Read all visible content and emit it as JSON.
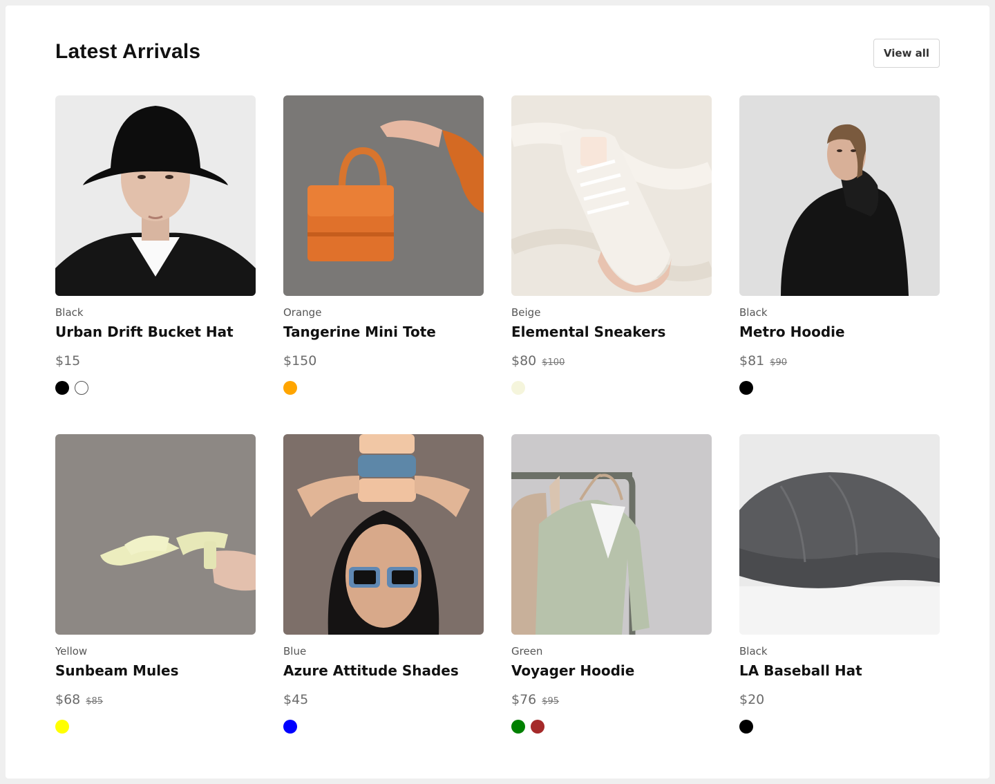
{
  "section": {
    "title": "Latest Arrivals",
    "view_all_label": "View all"
  },
  "products": [
    {
      "color": "Black",
      "name": "Urban Drift Bucket Hat",
      "price": "$15",
      "old_price": "",
      "swatches": [
        "#000000",
        "#ffffff"
      ],
      "image": "man-in-black-bucket-hat"
    },
    {
      "color": "Orange",
      "name": "Tangerine Mini Tote",
      "price": "$150",
      "old_price": "",
      "swatches": [
        "#ffa500"
      ],
      "image": "hand-holding-orange-mini-bag"
    },
    {
      "color": "Beige",
      "name": "Elemental Sneakers",
      "price": "$80",
      "old_price": "$100",
      "swatches": [
        "#f5f5dc"
      ],
      "image": "white-sneaker-on-cream-fabric"
    },
    {
      "color": "Black",
      "name": "Metro Hoodie",
      "price": "$81",
      "old_price": "$90",
      "swatches": [
        "#000000"
      ],
      "image": "woman-in-black-hoodie"
    },
    {
      "color": "Yellow",
      "name": "Sunbeam Mules",
      "price": "$68",
      "old_price": "$85",
      "swatches": [
        "#ffff00"
      ],
      "image": "hand-holding-yellow-mules"
    },
    {
      "color": "Blue",
      "name": "Azure Attitude Shades",
      "price": "$45",
      "old_price": "",
      "swatches": [
        "#0000ff"
      ],
      "image": "woman-with-blue-sunglasses"
    },
    {
      "color": "Green",
      "name": "Voyager Hoodie",
      "price": "$76",
      "old_price": "$95",
      "swatches": [
        "#008000",
        "#a52a2a"
      ],
      "image": "green-hoodie-on-rack"
    },
    {
      "color": "Black",
      "name": "LA Baseball Hat",
      "price": "$20",
      "old_price": "",
      "swatches": [
        "#000000"
      ],
      "image": "grey-washed-baseball-cap"
    }
  ]
}
